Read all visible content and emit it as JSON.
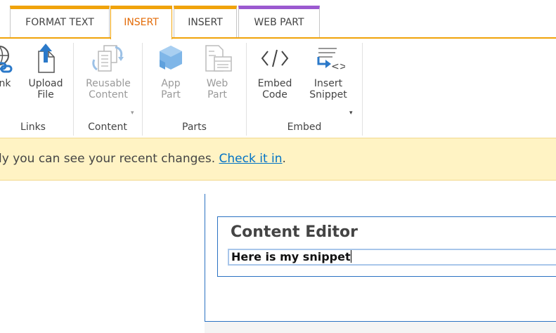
{
  "tabs": [
    {
      "label": "FORMAT TEXT",
      "active": false
    },
    {
      "label": "INSERT",
      "active": true
    },
    {
      "label": "INSERT",
      "active": false
    },
    {
      "label": "WEB PART",
      "active": false
    }
  ],
  "ribbon": {
    "groups": {
      "links": {
        "label": "Links",
        "buttons": [
          {
            "label": "nk",
            "icon": "link-icon"
          },
          {
            "label": "Upload\nFile",
            "icon": "upload-file-icon"
          }
        ]
      },
      "content": {
        "label": "Content",
        "buttons": [
          {
            "label": "Reusable\nContent",
            "icon": "reusable-content-icon",
            "disabled": true,
            "dropdown": true
          }
        ]
      },
      "parts": {
        "label": "Parts",
        "buttons": [
          {
            "label": "App\nPart",
            "icon": "app-part-icon",
            "disabled": true
          },
          {
            "label": "Web\nPart",
            "icon": "web-part-icon",
            "disabled": true
          }
        ]
      },
      "embed": {
        "label": "Embed",
        "buttons": [
          {
            "label": "Embed\nCode",
            "icon": "embed-code-icon"
          },
          {
            "label": "Insert\nSnippet",
            "icon": "insert-snippet-icon",
            "dropdown": true
          }
        ]
      }
    }
  },
  "status": {
    "text": "ly you can see your recent changes. ",
    "link": "Check it in",
    "suffix": "."
  },
  "editor": {
    "title": "Content Editor",
    "body": "Here is my snippet"
  },
  "colors": {
    "tab_accent": "#f0a30a",
    "webpart_accent": "#9b59d0",
    "active_tab_text": "#e36c09",
    "link": "#0072c6",
    "status_bg": "#fff3c4",
    "editor_border": "#2b72c2",
    "icon_blue": "#2b79c9"
  }
}
